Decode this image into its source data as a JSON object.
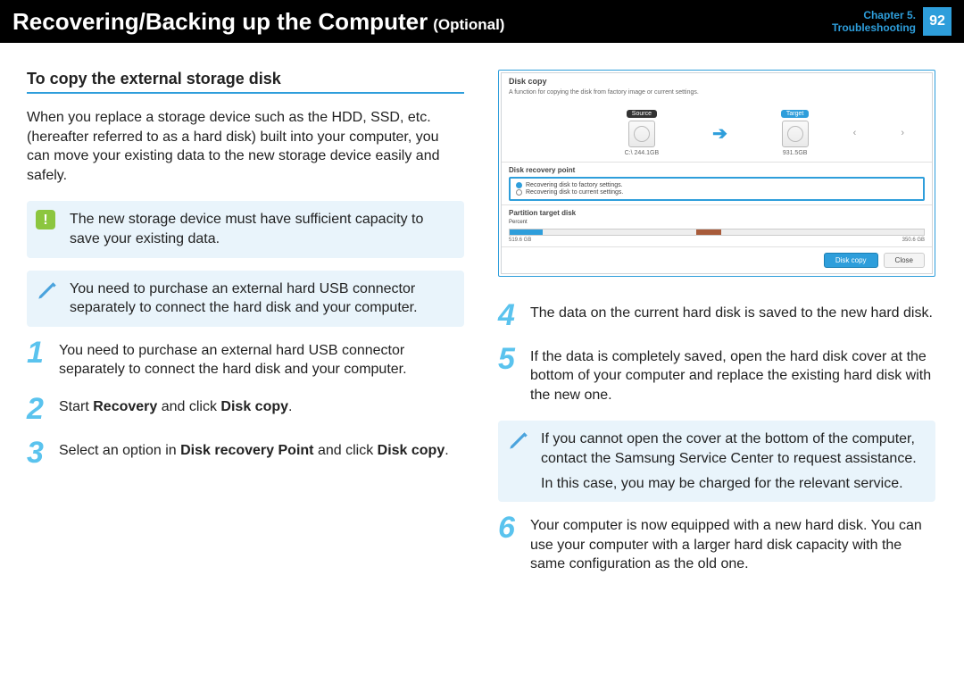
{
  "header": {
    "title": "Recovering/Backing up the Computer",
    "optional": "(Optional)",
    "chapter_line1": "Chapter 5.",
    "chapter_line2": "Troubleshooting",
    "page": "92"
  },
  "left": {
    "section_title": "To copy the external storage disk",
    "intro": "When you replace a storage device such as the HDD, SSD, etc. (hereafter referred to as a hard disk) built into your computer, you can move your existing data to the new storage device easily and safely.",
    "warn": "The new storage device must have sufficient capacity to save your existing data.",
    "note": "You need to purchase an external hard USB connector separately to connect the hard disk and your computer.",
    "step1": "You need to purchase an external hard USB connector separately to connect the hard disk and your computer.",
    "step2_prefix": "Start ",
    "step2_b1": "Recovery",
    "step2_mid": " and click ",
    "step2_b2": "Disk copy",
    "step2_suffix": ".",
    "step3_prefix": "Select an option in ",
    "step3_b1": "Disk recovery Point",
    "step3_mid": " and click ",
    "step3_b2": "Disk copy",
    "step3_suffix": "."
  },
  "right": {
    "shot": {
      "title": "Disk copy",
      "desc": "A function for copying the disk from factory image or current settings.",
      "src_label": "Source",
      "tgt_label": "Target",
      "src_size": "C:\\ 244.1GB",
      "tgt_size": "931.5GB",
      "sec1_title": "Disk recovery point",
      "opt1": "Recovering disk to factory settings.",
      "opt2": "Recovering disk to current settings.",
      "sec2_title": "Partition target disk",
      "percent": "Percent",
      "p_left": "519.6 GB",
      "p_right": "350.6 GB",
      "btn_copy": "Disk copy",
      "btn_close": "Close"
    },
    "step4": "The data on the current hard disk is saved to the new hard disk.",
    "step5": "If the data is completely saved, open the hard disk cover at the bottom of your computer and replace the existing hard disk with the new one.",
    "note_p1": "If you cannot open the cover at the bottom of the computer, contact the Samsung Service Center to request assistance.",
    "note_p2": "In this case, you may be charged for the relevant service.",
    "step6": "Your computer is now equipped with a new hard disk. You can use your computer with a larger hard disk capacity with the same configuration as the old one."
  },
  "nums": {
    "n1": "1",
    "n2": "2",
    "n3": "3",
    "n4": "4",
    "n5": "5",
    "n6": "6"
  }
}
